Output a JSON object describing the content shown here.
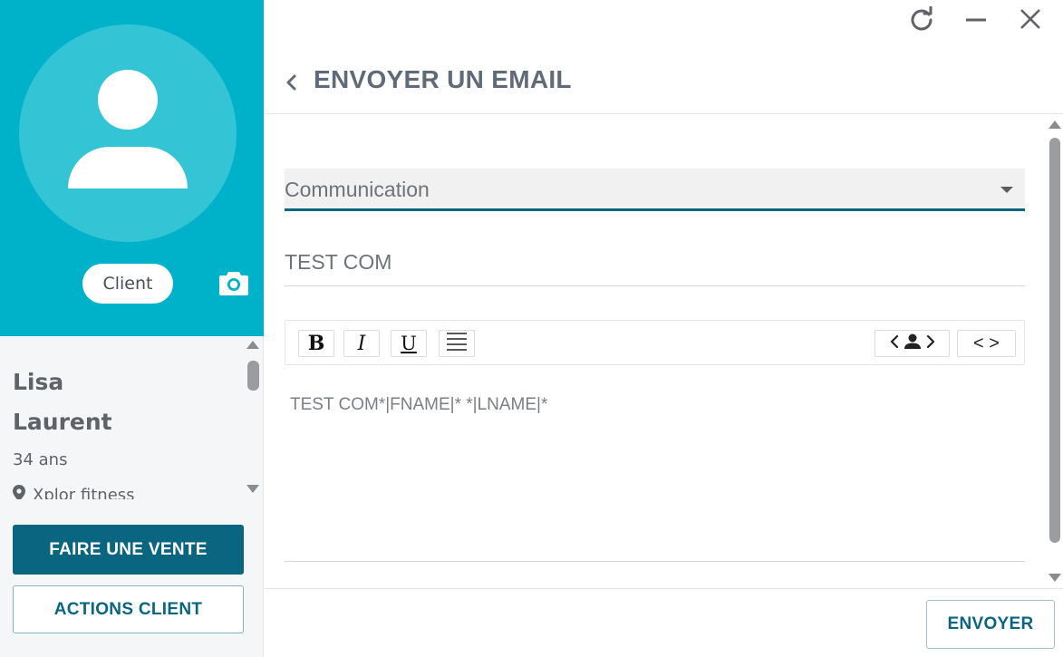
{
  "profile": {
    "badge": "Client",
    "first_name": "Lisa",
    "last_name": "Laurent",
    "age": "34 ans",
    "location": "Xplor fitness"
  },
  "left_actions": {
    "sale_label": "FAIRE UNE VENTE",
    "actions_label": "ACTIONS CLIENT"
  },
  "header": {
    "title": "ENVOYER UN EMAIL"
  },
  "form": {
    "template_select": "Communication",
    "subject_value": "TEST COM",
    "body_text": "TEST COM*|FNAME|* *|LNAME|*"
  },
  "toolbar": {
    "bold": "B",
    "italic": "I",
    "underline": "U",
    "code": "< >"
  },
  "footer": {
    "send_label": "ENVOYER"
  },
  "colors": {
    "brand_teal": "#00b2c9",
    "primary_dark": "#0a6580"
  }
}
